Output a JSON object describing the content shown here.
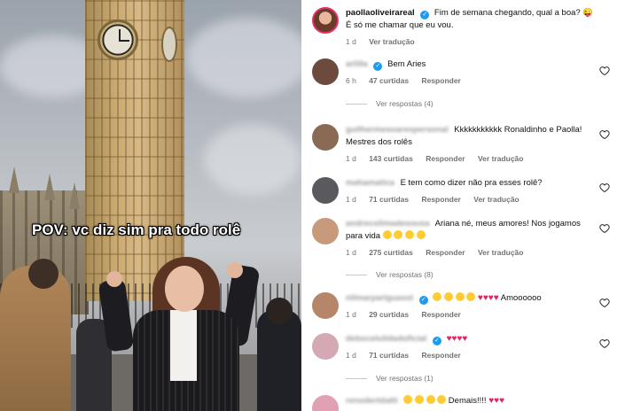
{
  "video": {
    "caption": "POV: vc diz sim pra todo rolê"
  },
  "post": {
    "username": "paollaoliveirareal",
    "caption_line1": "Fim de semana chegando, qual a boa? 😜",
    "caption_line2": "É só me chamar que eu vou.",
    "time": "1 d",
    "translate": "Ver tradução"
  },
  "comments": [
    {
      "username": "arlilla",
      "verified": true,
      "text": "Bem Aries",
      "time": "6 h",
      "likes": "47 curtidas",
      "reply": "Responder",
      "translate": "",
      "view_replies": "Ver respostas (4)",
      "avatar_color": "#6c4a3e"
    },
    {
      "username": "guilhermesoarespersonal",
      "verified": false,
      "text": "Kkkkkkkkkkk Ronaldinho e Paolla! Mestres dos rolês",
      "time": "1 d",
      "likes": "143 curtidas",
      "reply": "Responder",
      "translate": "Ver tradução",
      "view_replies": "",
      "avatar_color": "#8a6a55"
    },
    {
      "username": "mahamatica",
      "verified": false,
      "text": "E tem como dizer não pra esses rolê?",
      "time": "1 d",
      "likes": "71 curtidas",
      "reply": "Responder",
      "translate": "Ver tradução",
      "view_replies": "",
      "avatar_color": "#5a5a5e"
    },
    {
      "username": "andrecolimadesousa",
      "verified": false,
      "text": "Ariana né, meus amores! Nos jogamos para vida",
      "time": "1 d",
      "likes": "275 curtidas",
      "reply": "Responder",
      "translate": "Ver tradução",
      "view_replies": "Ver respostas (8)",
      "avatar_color": "#c79a7c"
    },
    {
      "username": "nilmarpariguassl",
      "verified": true,
      "text": "Amoooooo",
      "time": "1 d",
      "likes": "29 curtidas",
      "reply": "Responder",
      "translate": "",
      "view_replies": "",
      "avatar_color": "#b5866a"
    },
    {
      "username": "debocelulidadoficial",
      "verified": true,
      "text": "",
      "time": "1 d",
      "likes": "71 curtidas",
      "reply": "Responder",
      "translate": "",
      "view_replies": "Ver respostas (1)",
      "avatar_color": "#d5a9b3"
    },
    {
      "username": "renodertdatti",
      "verified": false,
      "text": "Demais!!!!",
      "time": "",
      "likes": "",
      "reply": "",
      "translate": "",
      "view_replies": "",
      "avatar_color": "#e2a0b4"
    }
  ],
  "colors": {
    "verified": "#1d9bf0",
    "meta_text": "#737373",
    "heart_red": "#e0245e"
  }
}
